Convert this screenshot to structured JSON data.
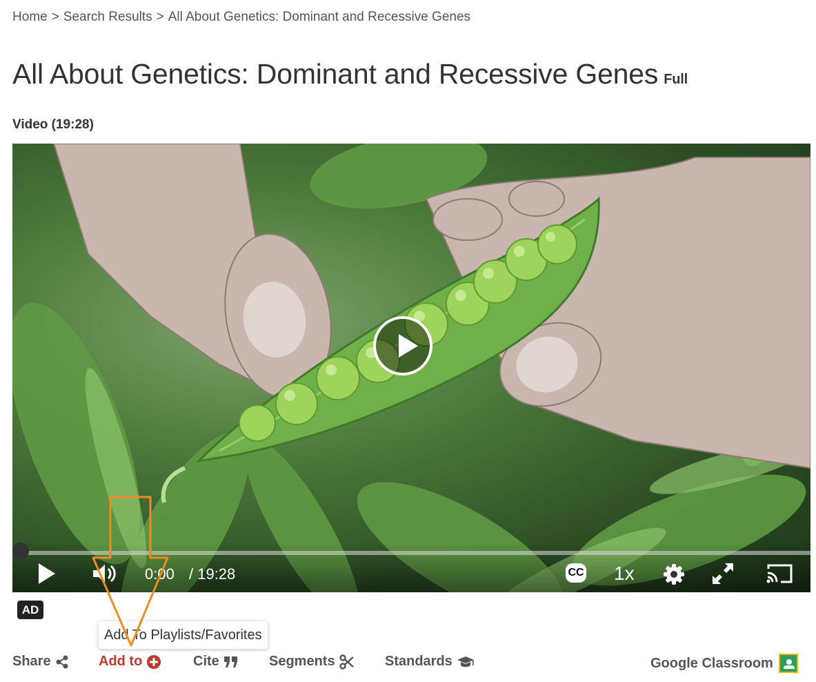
{
  "breadcrumb": {
    "home": "Home",
    "search": "Search Results",
    "current": "All About Genetics: Dominant and Recessive Genes",
    "separator": ">"
  },
  "title": {
    "text": "All About Genetics: Dominant and Recessive Genes",
    "tag": "Full"
  },
  "video": {
    "meta": "Video (19:28)",
    "current_time": "0:00",
    "total_time": "/ 19:28",
    "cc_label": "CC",
    "speed": "1x",
    "progress": 0.0
  },
  "ad_badge": "AD",
  "tooltip": "Add To Playlists/Favorites",
  "actions": {
    "share": "Share",
    "add_to": "Add to",
    "cite": "Cite",
    "segments": "Segments",
    "standards": "Standards",
    "google_classroom": "Google Classroom"
  },
  "colors": {
    "active_action": "#c0392b",
    "annotation_arrow": "#f08a24",
    "google_classroom_green": "#2e9e58",
    "google_classroom_border": "#f7b500"
  },
  "icons": {
    "share": "share-icon",
    "add_to": "plus-circle-icon",
    "cite": "quote-icon",
    "segments": "scissors-icon",
    "standards": "graduation-cap-icon",
    "google_classroom": "google-classroom-icon",
    "play": "play-icon",
    "volume": "volume-icon",
    "settings": "gear-icon",
    "fullscreen": "fullscreen-icon",
    "cast": "cast-icon"
  }
}
